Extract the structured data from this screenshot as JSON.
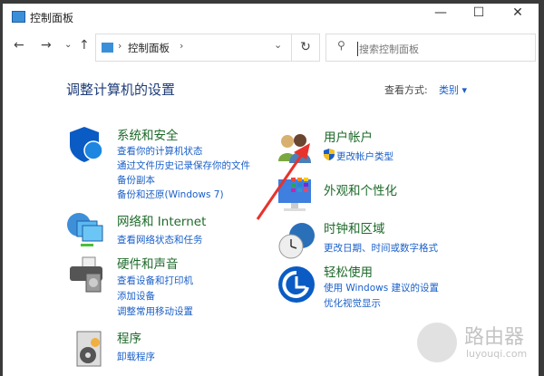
{
  "window": {
    "title": "控制面板",
    "minimize": "—",
    "maximize": "☐",
    "close": "✕"
  },
  "nav": {
    "back": "←",
    "forward": "→",
    "recent": "⌄",
    "up": "↑",
    "breadcrumb": "控制面板",
    "sep": "›",
    "dropdown": "⌄",
    "refresh": "↻",
    "search_placeholder": "搜索控制面板"
  },
  "header": {
    "title": "调整计算机的设置",
    "view_label": "查看方式:",
    "view_value": "类别 ▾"
  },
  "left": [
    {
      "title": "系统和安全",
      "links": [
        "查看你的计算机状态",
        "通过文件历史记录保存你的文件",
        "备份副本",
        "备份和还原(Windows 7)"
      ]
    },
    {
      "title": "网络和 Internet",
      "links": [
        "查看网络状态和任务"
      ]
    },
    {
      "title": "硬件和声音",
      "links": [
        "查看设备和打印机",
        "添加设备",
        "调整常用移动设置"
      ]
    },
    {
      "title": "程序",
      "links": [
        "卸载程序"
      ]
    }
  ],
  "right": [
    {
      "title": "用户帐户",
      "links": [
        "更改帐户类型"
      ]
    },
    {
      "title": "外观和个性化",
      "links": []
    },
    {
      "title": "时钟和区域",
      "links": [
        "更改日期、时间或数字格式"
      ]
    },
    {
      "title": "轻松使用",
      "links": [
        "使用 Windows 建议的设置",
        "优化视觉显示"
      ]
    }
  ],
  "watermark": {
    "name": "路由器",
    "url": "luyouqi.com"
  }
}
